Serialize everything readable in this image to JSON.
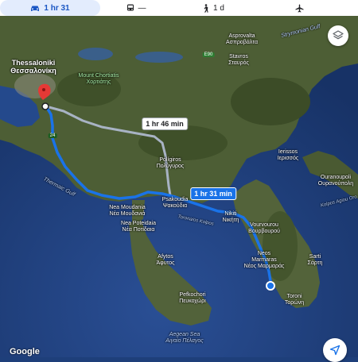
{
  "travel_modes": [
    {
      "name": "driving",
      "value": "1 hr 31",
      "selected": true
    },
    {
      "name": "transit",
      "value": "—",
      "selected": false
    },
    {
      "name": "walking",
      "value": "1 d",
      "selected": false
    },
    {
      "name": "flight",
      "value": "",
      "selected": false
    }
  ],
  "map": {
    "routes": {
      "main_duration": "1 hr 31 min",
      "alt_duration": "1 hr 46 min"
    },
    "road_shields": {
      "e90": "E90",
      "n24": "24"
    },
    "places": {
      "thessaloniki_en": "Thessaloniki",
      "thessaloniki_gr": "Θεσσαλονίκη",
      "chortiatis_en": "Mount Chortiatis",
      "chortiatis_gr": "Χορτιάτης",
      "asprovalta_en": "Asprovalta",
      "asprovalta_gr": "Ασπροβάλτα",
      "stavros_en": "Stavros",
      "stavros_gr": "Σταυρός",
      "strymonian_gulf": "Strymonian Gulf",
      "polygyros_en": "Polígiros",
      "polygyros_gr": "Πολύγυρος",
      "ierissos_en": "Ierissos",
      "ierissos_gr": "Ιερισσός",
      "ouranoupoli_en": "Ouranoupoli",
      "ouranoupoli_gr": "Ουρανούπολη",
      "agion_oros_gulf": "Kolpos Agiou Oro",
      "thermaic_gulf": "Thermaic Gulf",
      "nea_moudania_en": "Nea Moudania",
      "nea_moudania_gr": "Νέα Μουδανιά",
      "nea_poteidaia_en": "Nea Poteidaia",
      "nea_poteidaia_gr": "Νέα Ποτίδαια",
      "psakoudia_en": "Psakoudia",
      "psakoudia_gr": "Ψακούδια",
      "toronaios_gulf": "Toronaios Kolpos",
      "nikiti_en": "Nikiti",
      "nikiti_gr": "Νικήτη",
      "vourvourou_en": "Vourvourou",
      "vourvourou_gr": "Βουρβουρού",
      "neos_marmaras_en1": "Neos",
      "neos_marmaras_en2": "Marmaras",
      "neos_marmaras_gr": "Νέος Μαρμαράς",
      "sarti_en": "Sarti",
      "sarti_gr": "Σάρτη",
      "afytos_en": "Afytos",
      "afytos_gr": "Άφυτος",
      "pefkochori_en": "Pefkochori",
      "pefkochori_gr": "Πευκοχώρι",
      "toroni_en": "Toroni",
      "toroni_gr": "Τορώνη",
      "aegean_sea_en": "Aegean Sea",
      "aegean_sea_gr": "Αιγαίο Πέλαγος"
    }
  },
  "attribution": "Google",
  "icons": {
    "car": "car-icon",
    "transit": "bus-icon",
    "walk": "walk-icon",
    "flight": "plane-icon",
    "layers": "layers-icon",
    "navigate": "navigation-arrow-icon",
    "destination": "red-pin-icon",
    "origin": "blue-dot-icon"
  },
  "colors": {
    "route_main": "#1a73e8",
    "route_alt": "#a8b3c4",
    "pin": "#e53935",
    "sea": "#1e3f7a",
    "land": "#4a5a32"
  }
}
